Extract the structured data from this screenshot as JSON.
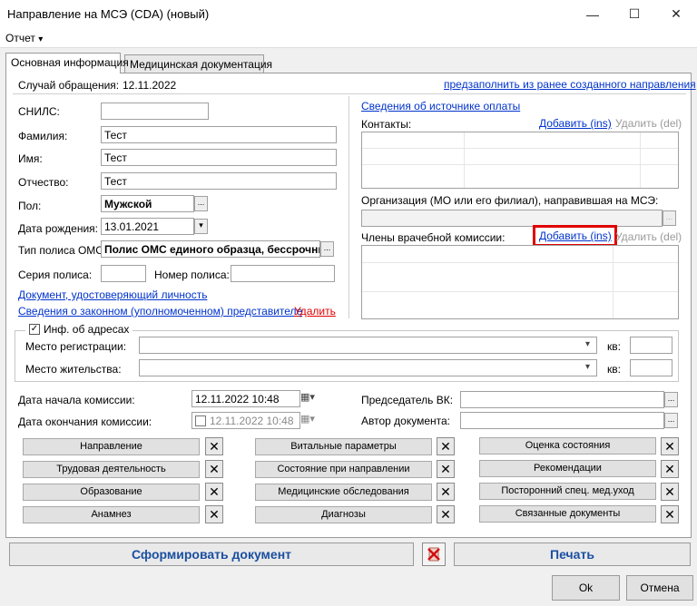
{
  "window": {
    "title": "Направление на МСЭ (CDA) (новый)",
    "minimize": "—",
    "maximize": "☐",
    "close": "✕"
  },
  "menu": {
    "report": "Отчет",
    "arrow": "▾"
  },
  "tabs": [
    {
      "label": "Основная информация"
    },
    {
      "label": "Медицинская документация"
    }
  ],
  "left": {
    "case_label": "Случай обращения:",
    "case_date": "12.11.2022",
    "snils_label": "СНИЛС:",
    "snils_value": "",
    "surname_label": "Фамилия:",
    "surname_value": "Тест",
    "name_label": "Имя:",
    "name_value": "Тест",
    "patronymic_label": "Отчество:",
    "patronymic_value": "Тест",
    "sex_label": "Пол:",
    "sex_value": "Мужской",
    "dob_label": "Дата рождения:",
    "dob_value": "13.01.2021",
    "policy_type_label": "Тип полиса ОМС:",
    "policy_type_value": "Полис ОМС единого образца, бессрочный",
    "policy_series_label": "Серия полиса:",
    "policy_number_label": "Номер полиса:",
    "identity_doc_link": "Документ, удостоверяющий личность",
    "representative_link": "Сведения о законном (уполномоченном) представителе",
    "delete_link": "Удалить"
  },
  "right": {
    "prefill_link": "предзаполнить из ранее созданного направления",
    "payment_source_link": "Сведения об источнике оплаты",
    "contacts_label": "Контакты:",
    "add_ins": "Добавить (ins)",
    "del_del": "Удалить (del)",
    "org_label": "Организация (МО или его филиал), направившая на МСЭ:",
    "commission_label": "Члены врачебной комиссии:"
  },
  "address": {
    "checkbox_label": "Инф. об адресах",
    "check_mark": "✓",
    "registration_label": "Место регистрации:",
    "residence_label": "Место жительства:",
    "apt_label": "кв:"
  },
  "commission": {
    "start_label": "Дата начала комиссии:",
    "start_value": "12.11.2022 10:48",
    "end_label": "Дата окончания комиссии:",
    "end_value": "12.11.2022 10:48",
    "chairman_label": "Председатель ВК:",
    "author_label": "Автор документа:"
  },
  "sections": {
    "col1": [
      "Направление",
      "Трудовая деятельность",
      "Образование",
      "Анамнез"
    ],
    "col2": [
      "Витальные параметры",
      "Состояние при направлении",
      "Медицинские обследования",
      "Диагнозы"
    ],
    "col3": [
      "Оценка состояния",
      "Рекомендации",
      "Посторонний спец. мед.уход",
      "Связанные документы"
    ],
    "x_glyph": "✕"
  },
  "actions": {
    "generate": "Сформировать документ",
    "print": "Печать",
    "ok": "Ok",
    "cancel": "Отмена"
  },
  "icons": {
    "ellipsis": "...",
    "dropdown": "▾",
    "calendar": "▦"
  },
  "colors": {
    "link": "#0033cc",
    "highlight": "#e00000",
    "primary_text": "#1a4fa0"
  }
}
